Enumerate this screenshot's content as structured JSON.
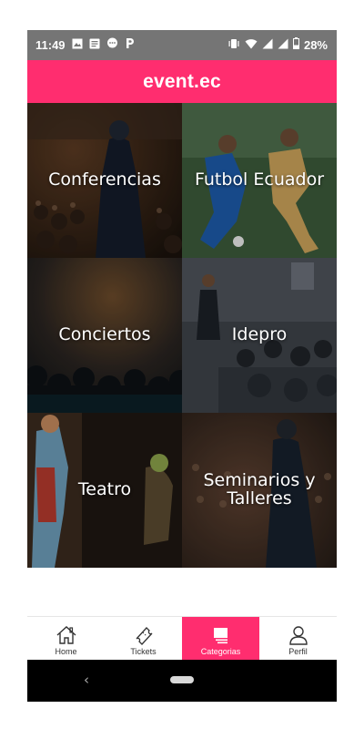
{
  "status_bar": {
    "time": "11:49",
    "battery": "28%",
    "left_icons": [
      "image-icon",
      "message-icon",
      "chat-bubble-icon",
      "p-app-icon"
    ],
    "right_icons": [
      "vibrate-icon",
      "wifi-icon",
      "signal-icon",
      "signal-icon",
      "battery-icon"
    ]
  },
  "app_bar": {
    "title": "event.ec",
    "color": "#ff2d6f"
  },
  "categories": [
    {
      "label": "Conferencias"
    },
    {
      "label": "Futbol Ecuador"
    },
    {
      "label": "Conciertos"
    },
    {
      "label": "Idepro"
    },
    {
      "label": "Teatro"
    },
    {
      "label": "Seminarios y Talleres"
    }
  ],
  "bottom_nav": {
    "items": [
      {
        "label": "Home",
        "icon": "home-icon"
      },
      {
        "label": "Tickets",
        "icon": "ticket-icon"
      },
      {
        "label": "Categorias",
        "icon": "categories-icon",
        "active": true
      },
      {
        "label": "Perfil",
        "icon": "user-icon"
      }
    ],
    "active_color": "#ff2d6f"
  },
  "system_nav": {
    "back_icon": "back-icon",
    "home_icon": "home-pill-icon"
  }
}
